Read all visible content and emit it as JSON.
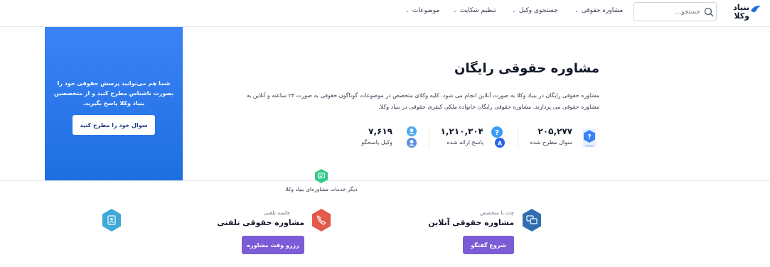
{
  "header": {
    "logo_line1": "بنیاد",
    "logo_line2": "وکلا",
    "search_placeholder": "جستجو...",
    "nav": [
      {
        "label": "مشاوره حقوقی"
      },
      {
        "label": "جستجوی وکیل"
      },
      {
        "label": "تنظیم شکایت"
      },
      {
        "label": "موضوعات"
      }
    ]
  },
  "sidebar_card": {
    "text": "شما هم می‌توانید پرسش حقوقی خود را بصورت ناشناس مطرح کنید و از متخصصین بنیاد وکلا پاسخ بگیرید.",
    "button": "سوال خود را مطرح کنید"
  },
  "main": {
    "title": "مشاوره حقوقی رایگان",
    "description": "مشاوره حقوقی رایگان در بنیاد وکلا به صورت آنلاین انجام می شود. کلیه وکلای متخصص در موضوعات گوناگون حقوقی به صورت ۲۴ ساعته و آنلاین به مشاوره حقوقی می پردازند. مشاوره حقوقی رایگان خانواده ملکی کیفری حقوقی در بنیاد وکلا.",
    "stats": [
      {
        "value": "۲۰۵,۲۷۷",
        "label": "سوال مطرح شده"
      },
      {
        "value": "۱,۲۱۰,۳۰۴",
        "label": "پاسخ ارائه شده"
      },
      {
        "value": "۷,۶۱۹",
        "label": "وکیل پاسخگو"
      }
    ]
  },
  "services": {
    "section_label": "دیگر خدمات مشاوره‌ای بنیاد وکلا",
    "items": [
      {
        "subtitle": "چت با متخصص",
        "title": "مشاوره حقوقی آنلاین",
        "button": "شروع گفتگو"
      },
      {
        "subtitle": "جلسه تلفنی",
        "title": "مشاوره حقوقی تلفنی",
        "button": "رزرو وقت مشاوره"
      }
    ]
  },
  "colors": {
    "primary_blue": "#2b7de9",
    "purple": "#7c5cd6",
    "hex_blue": "#2f6fb0",
    "hex_red": "#e25a4a",
    "hex_teal": "#3ea8d6",
    "hex_green": "#34c98a"
  }
}
